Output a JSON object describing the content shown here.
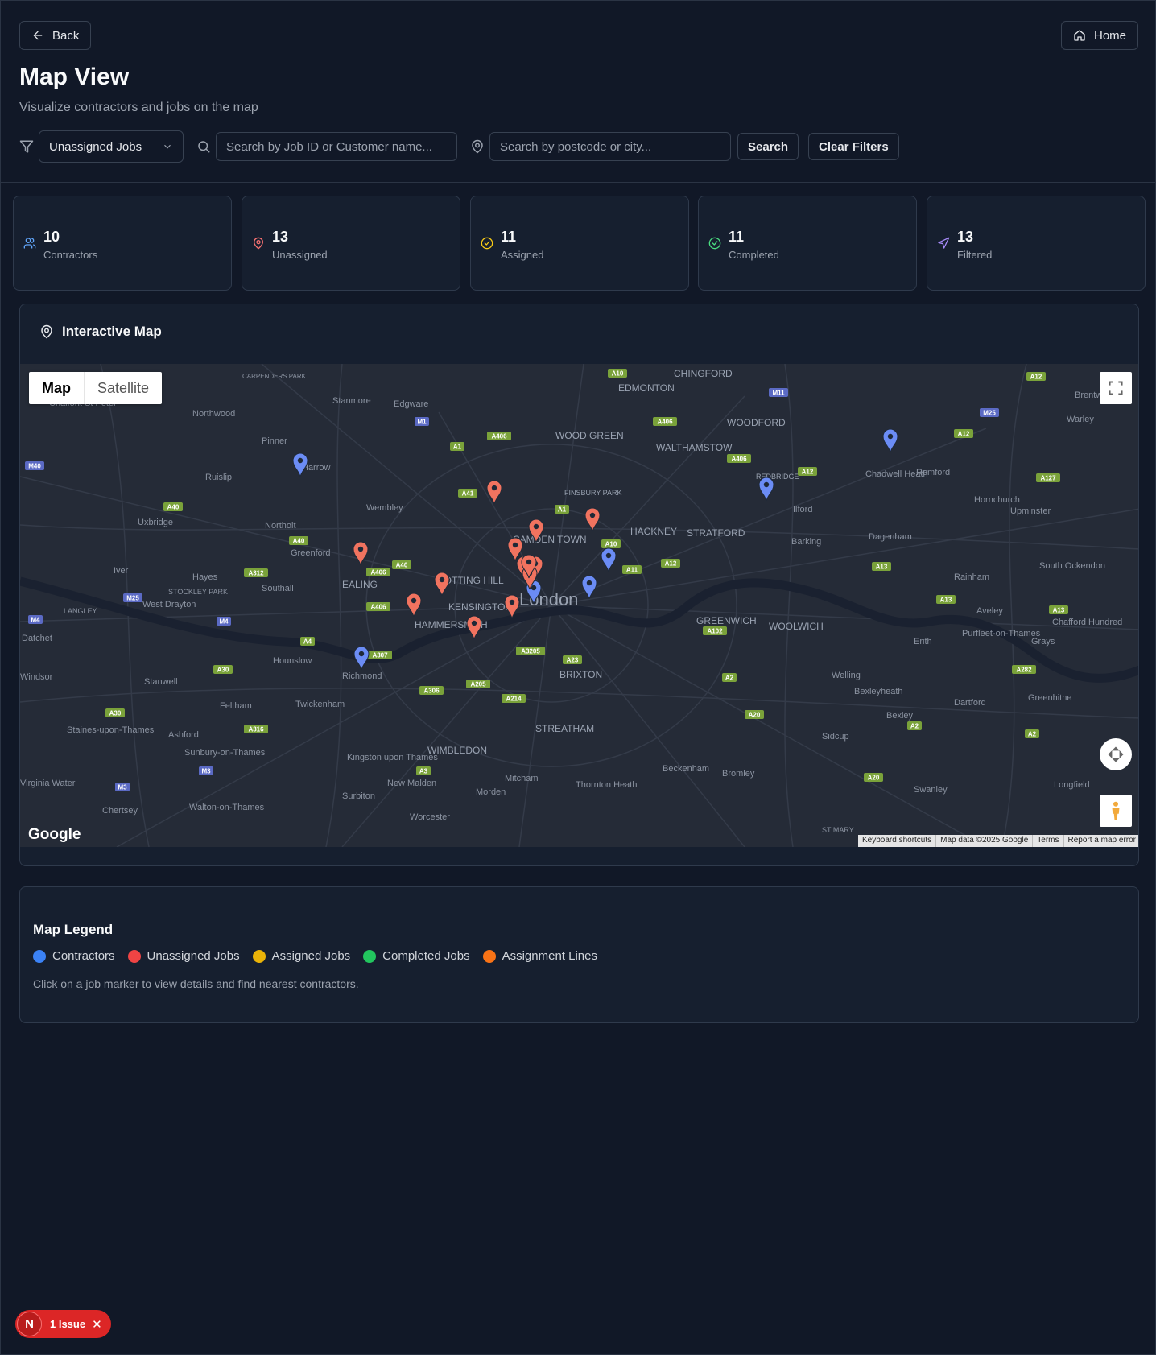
{
  "nav": {
    "back_label": "Back",
    "home_label": "Home"
  },
  "header": {
    "title": "Map View",
    "subtitle": "Visualize contractors and jobs on the map"
  },
  "filters": {
    "job_filter_value": "Unassigned Jobs",
    "search_placeholder": "Search by Job ID or Customer name...",
    "location_placeholder": "Search by postcode or city...",
    "search_label": "Search",
    "clear_label": "Clear Filters"
  },
  "stats": [
    {
      "value": "10",
      "label": "Contractors",
      "icon": "users-icon",
      "color": "#60a5fa"
    },
    {
      "value": "13",
      "label": "Unassigned",
      "icon": "map-pin-icon",
      "color": "#f87171"
    },
    {
      "value": "11",
      "label": "Assigned",
      "icon": "clock-check-icon",
      "color": "#facc15"
    },
    {
      "value": "11",
      "label": "Completed",
      "icon": "check-circle-icon",
      "color": "#4ade80"
    },
    {
      "value": "13",
      "label": "Filtered",
      "icon": "navigation-icon",
      "color": "#a78bfa"
    }
  ],
  "map": {
    "card_title": "Interactive Map",
    "type_map": "Map",
    "type_satellite": "Satellite",
    "google": "Google",
    "attribution": [
      "Keyboard shortcuts",
      "Map data ©2025 Google",
      "Terms",
      "Report a map error"
    ],
    "place_labels": [
      "London",
      "CAMDEN TOWN",
      "NOTTING HILL",
      "KENSINGTON",
      "HAMMERSMITH",
      "EALING",
      "HACKNEY",
      "STRATFORD",
      "GREENWICH",
      "WOOLWICH",
      "WALTHAMSTOW",
      "WOOD GREEN",
      "EDMONTON",
      "CHINGFORD",
      "WOODFORD",
      "FINSBURY PARK",
      "BRIXTON",
      "STREATHAM",
      "WIMBLEDON",
      "Wembley",
      "Richmond",
      "Ilford",
      "Barking",
      "Romford",
      "Dagenham",
      "Hornchurch",
      "Upminster",
      "Rainham",
      "Harrow",
      "Northolt",
      "Greenford",
      "Southall",
      "Hayes",
      "Uxbridge",
      "Ruislip",
      "Pinner",
      "Northwood",
      "Stanmore",
      "Edgware",
      "Hounslow",
      "Twickenham",
      "Feltham",
      "Stanwell",
      "Ashford",
      "Kingston upon Thames",
      "New Malden",
      "Surbiton",
      "Mitcham",
      "Morden",
      "Thornton Heath",
      "Beckenham",
      "Bromley",
      "Sidcup",
      "Bexley",
      "Bexleyheath",
      "Welling",
      "Erith",
      "Dartford",
      "Greenhithe",
      "Swanley",
      "Longfield",
      "Aveley",
      "Grays",
      "South Ockendon",
      "Chadwell Heath",
      "Brentwood",
      "Warley",
      "Iver",
      "West Drayton",
      "Datchet",
      "Staines-upon-Thames",
      "Sunbury-on-Thames",
      "Walton-on-Thames",
      "Chertsey",
      "Worcester",
      "Purfleet-on-Thames",
      "Chafford Hundred",
      "Chalfont St Peter",
      "LANGLEY",
      "STOCKLEY PARK",
      "CARPENDERS PARK",
      "REDBRIDGE",
      "Windsor",
      "Virginia Water",
      "ST MARY"
    ],
    "contractor_count_on_map": 10,
    "job_markers_on_map": 13
  },
  "legend": {
    "title": "Map Legend",
    "items": [
      {
        "label": "Contractors",
        "color": "#3b82f6"
      },
      {
        "label": "Unassigned Jobs",
        "color": "#ef4444"
      },
      {
        "label": "Assigned Jobs",
        "color": "#eab308"
      },
      {
        "label": "Completed Jobs",
        "color": "#22c55e"
      },
      {
        "label": "Assignment Lines",
        "color": "#f97316"
      }
    ],
    "note": "Click on a job marker to view details and find nearest contractors."
  },
  "issue_badge": {
    "initial": "N",
    "label": "1 Issue"
  }
}
